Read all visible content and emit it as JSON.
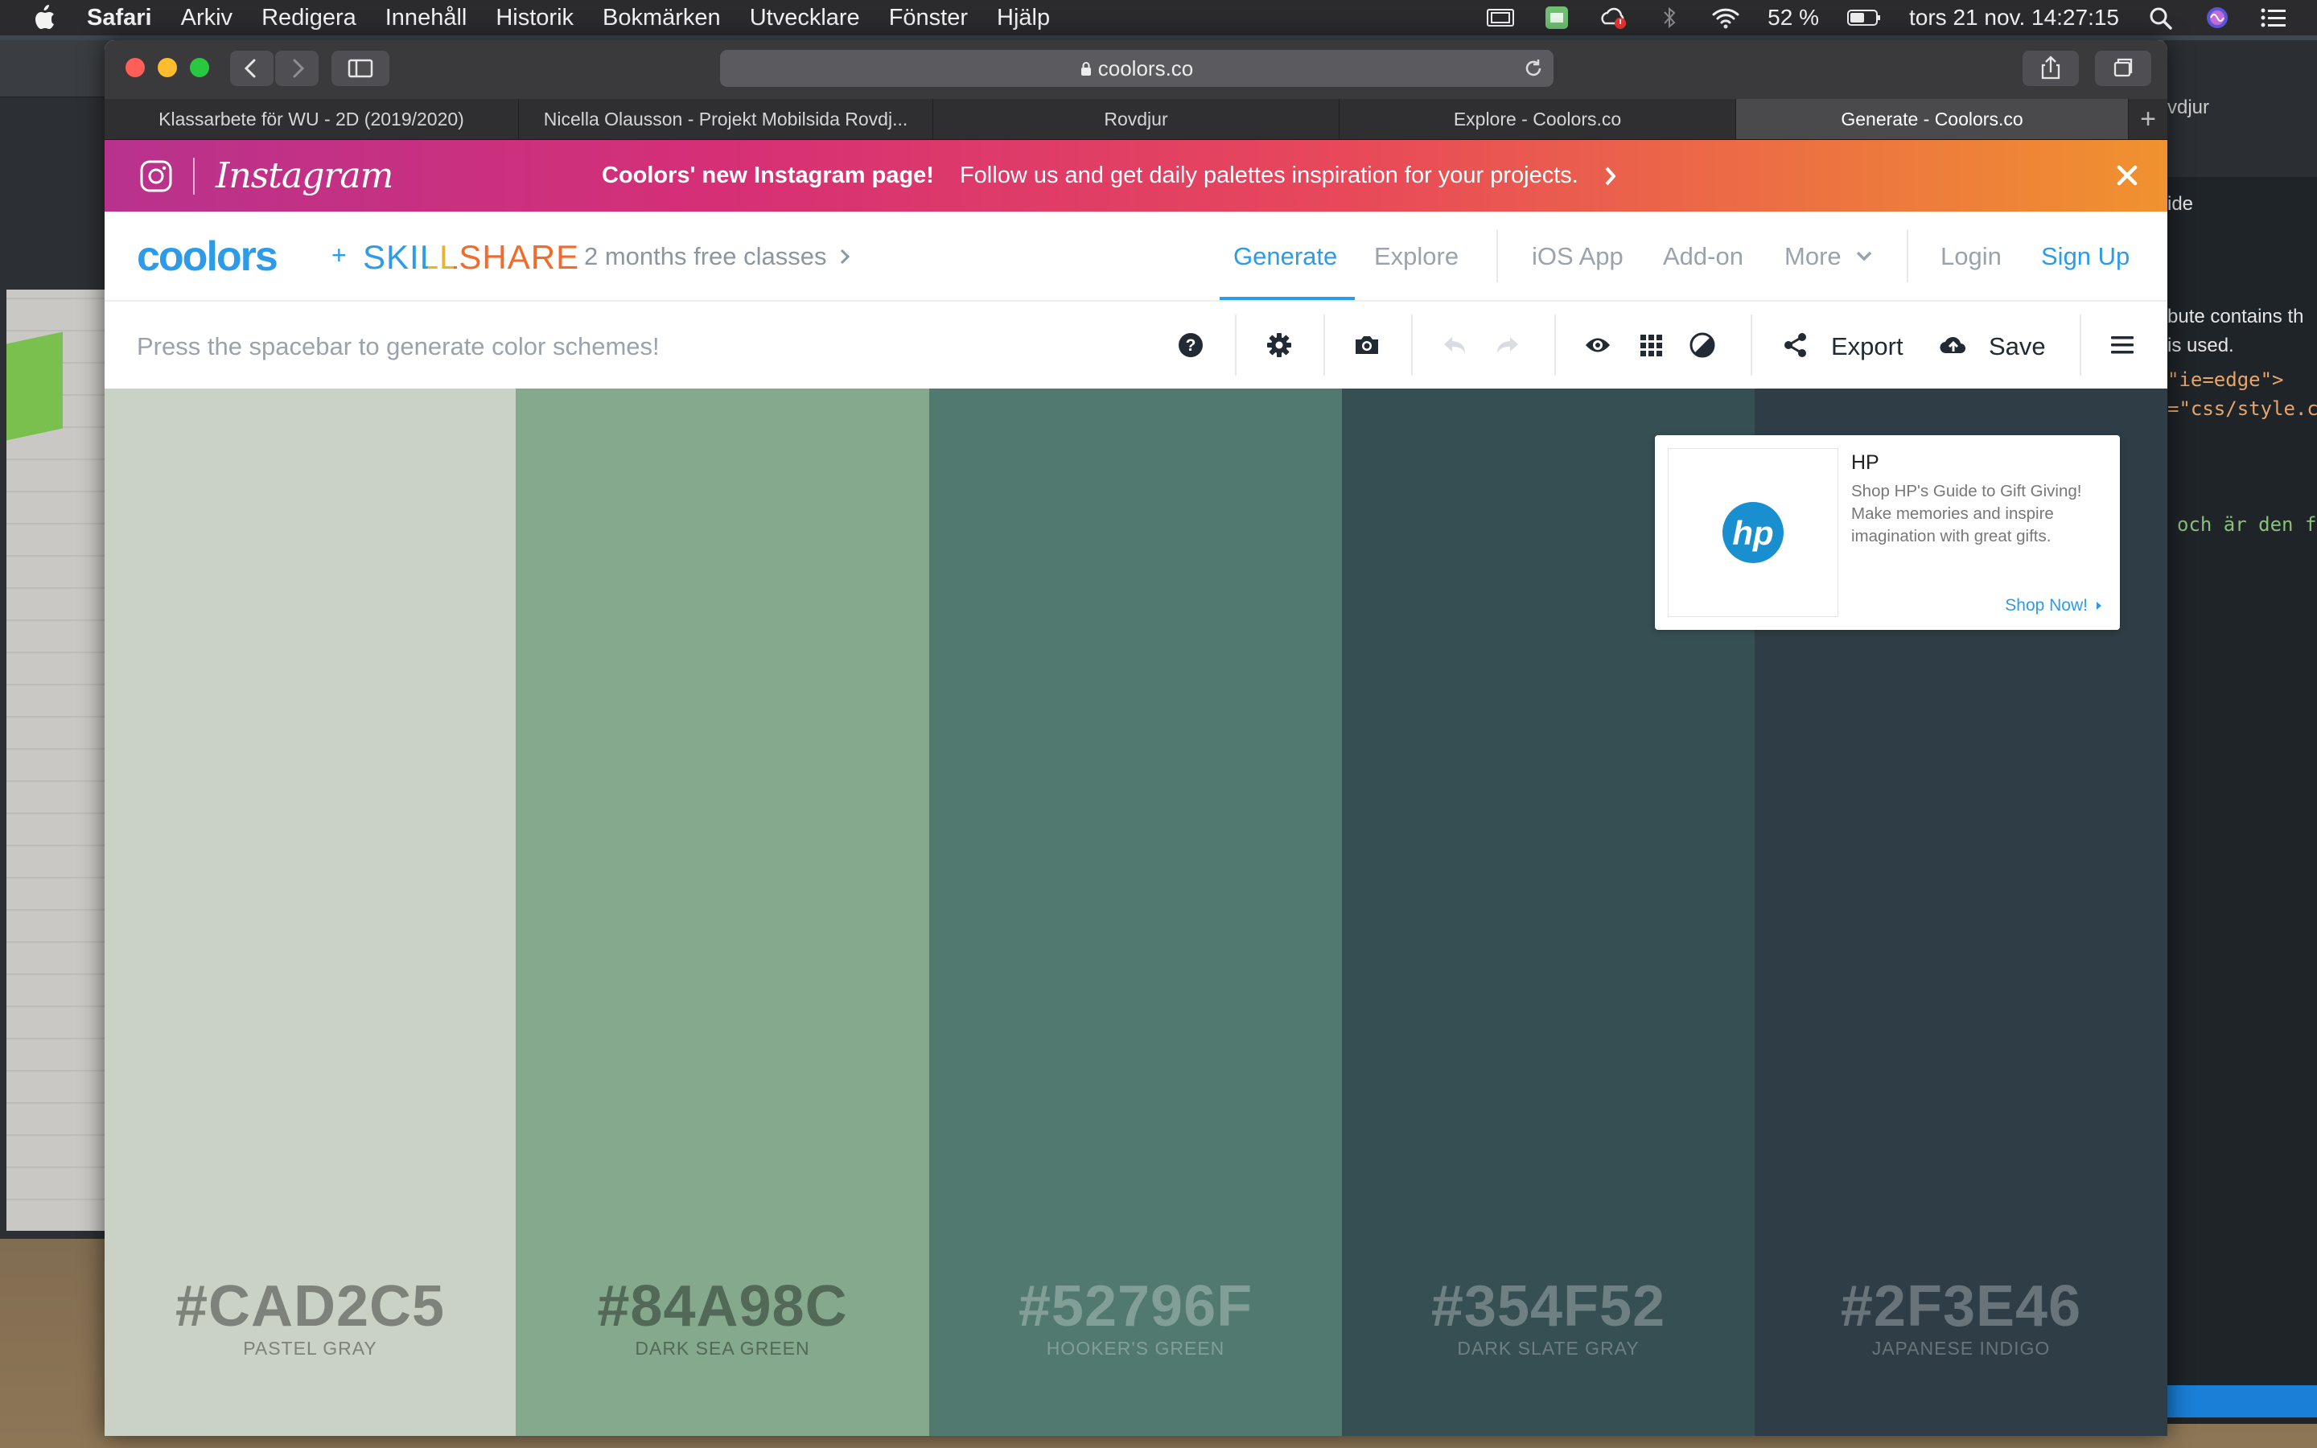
{
  "menubar": {
    "items": [
      "Safari",
      "Arkiv",
      "Redigera",
      "Innehåll",
      "Historik",
      "Bokmärken",
      "Utvecklare",
      "Fönster",
      "Hjälp"
    ],
    "battery": "52 %",
    "datetime": "tors 21 nov.  14:27:15"
  },
  "browser": {
    "url": "coolors.co",
    "tabs": [
      "Klassarbete för WU - 2D (2019/2020)",
      "Nicella Olausson - Projekt Mobilsida Rovdj...",
      "Rovdjur",
      "Explore - Coolors.co",
      "Generate - Coolors.co"
    ],
    "new_tab": "+"
  },
  "banner": {
    "brand": "Instagram",
    "headline": "Coolors' new Instagram page!",
    "text": "Follow us and get daily palettes inspiration for your projects."
  },
  "header": {
    "logo": "coolors",
    "plus": "+",
    "partner_logo": "SKILLSHARE",
    "promo": "2 months free classes",
    "nav": {
      "generate": "Generate",
      "explore": "Explore",
      "ios": "iOS App",
      "addon": "Add-on",
      "more": "More",
      "login": "Login",
      "signup": "Sign Up"
    }
  },
  "toolbar": {
    "hint": "Press the spacebar to generate color schemes!",
    "export": "Export",
    "save": "Save"
  },
  "palette": [
    {
      "hex": "#CAD2C5",
      "name": "PASTEL GRAY",
      "color": "#CAD2C5"
    },
    {
      "hex": "#84A98C",
      "name": "DARK SEA GREEN",
      "color": "#84A98C"
    },
    {
      "hex": "#52796F",
      "name": "HOOKER'S GREEN",
      "color": "#52796F"
    },
    {
      "hex": "#354F52",
      "name": "DARK SLATE GRAY",
      "color": "#354F52"
    },
    {
      "hex": "#2F3E46",
      "name": "JAPANESE INDIGO",
      "color": "#2F3E46"
    }
  ],
  "ad": {
    "logo": "hp",
    "title": "HP",
    "description": "Shop HP's Guide to Gift Giving! Make memories and inspire imagination with great gifts.",
    "cta": "Shop Now!"
  },
  "background_windows": {
    "right_tab": "vdjur",
    "lines": [
      "ide",
      "bute contains th",
      "is used.",
      "\"ie=edge\">",
      "=\"css/style.c",
      "och är den f"
    ]
  },
  "colors": {
    "accent": "#2e9be8",
    "skillshare_orange": "#f26b2a"
  }
}
